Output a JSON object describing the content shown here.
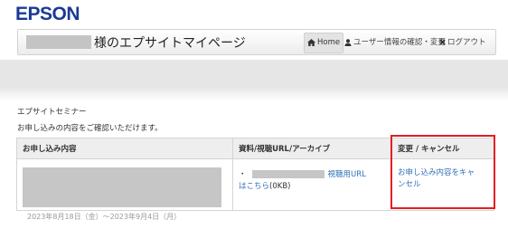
{
  "brand": {
    "logo_text": "EPSON",
    "color": "#1a3a94"
  },
  "header": {
    "title_suffix": "様のエプサイトマイページ",
    "nav": {
      "home_label": "Home",
      "profile_label": "ユーザー情報の確認・変更",
      "logout_label": "ログアウト"
    }
  },
  "section": {
    "title": "エプサイトセミナー",
    "intro": "お申し込みの内容をご確認いただけます。"
  },
  "table": {
    "columns": [
      "お申し込み内容",
      "資料/視聴URL/アーカイブ",
      "変更 / キャンセル"
    ],
    "row": {
      "material_bullet": "・",
      "material_link_part1": "視聴用URL",
      "material_link_part2": "はこちら",
      "material_size": "(0KB)",
      "cancel_link": "お申し込み内容をキャンセル"
    },
    "cut_off_text": "2023年8月18日（金）～2023年9月4日（月）"
  },
  "colors": {
    "link": "#2f6fb6",
    "highlight": "#e21e24"
  }
}
